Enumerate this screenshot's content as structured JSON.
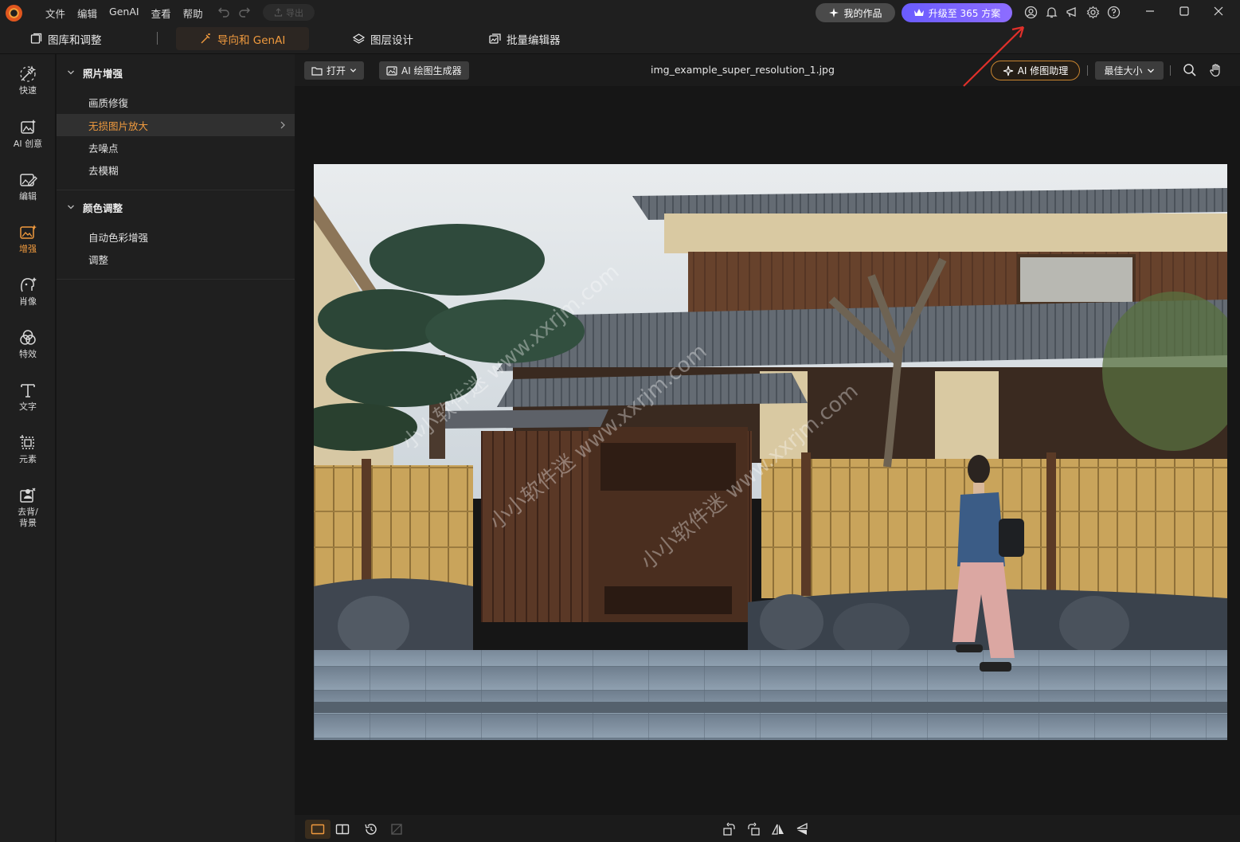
{
  "titlebar": {
    "menu": [
      "文件",
      "编辑",
      "GenAI",
      "查看",
      "帮助"
    ],
    "export_label": "导出",
    "my_works_label": "我的作品",
    "upgrade_label": "升级至 365 方案"
  },
  "modes": {
    "library": "图库和调整",
    "guided": "导向和 GenAI",
    "layers": "图层设计",
    "batch": "批量编辑器"
  },
  "rail": [
    {
      "label": "快速"
    },
    {
      "label": "AI 创意"
    },
    {
      "label": "编辑"
    },
    {
      "label": "增强"
    },
    {
      "label": "肖像"
    },
    {
      "label": "特效"
    },
    {
      "label": "文字"
    },
    {
      "label": "元素"
    },
    {
      "label": "去背/\n背景"
    }
  ],
  "panel": {
    "group1": {
      "title": "照片增强",
      "items": [
        "画质修復",
        "无损图片放大",
        "去噪点",
        "去模糊"
      ]
    },
    "group2": {
      "title": "颜色调整",
      "items": [
        "自动色彩增强",
        "调整"
      ]
    }
  },
  "canvas": {
    "open_label": "打开",
    "ai_gen_label": "AI 绘图生成器",
    "filename": "img_example_super_resolution_1.jpg",
    "assistant_label": "AI 修图助理",
    "zoom_label": "最佳大小"
  },
  "colors": {
    "accent": "#f09a3e",
    "upgrade": "#7a65ff",
    "annotation_arrow": "#e0302a"
  },
  "watermark": {
    "line1": "小小软件迷 www.xxrjm.com"
  }
}
